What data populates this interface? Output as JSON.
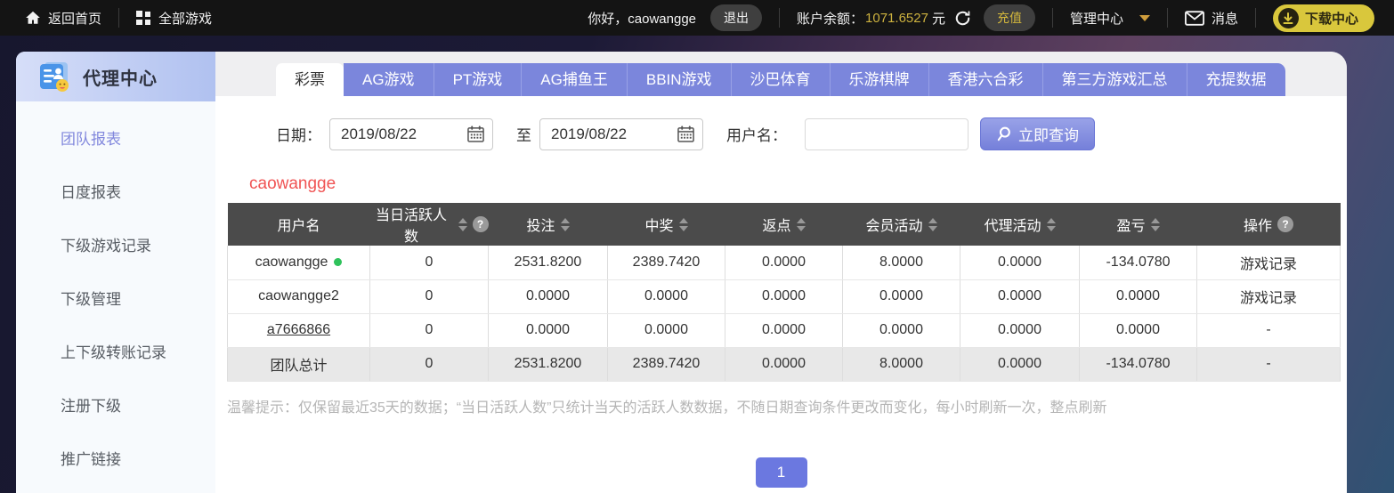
{
  "topbar": {
    "home": "返回首页",
    "all_games": "全部游戏",
    "greeting": "你好，caowangge",
    "logout": "退出",
    "balance_label": "账户余额：",
    "balance_value": "1071.6527",
    "balance_unit": "元",
    "recharge": "充值",
    "admin_center": "管理中心",
    "messages": "消息",
    "download_center": "下载中心"
  },
  "sidebar": {
    "title": "代理中心",
    "items": [
      {
        "label": "团队报表",
        "active": true
      },
      {
        "label": "日度报表",
        "active": false
      },
      {
        "label": "下级游戏记录",
        "active": false
      },
      {
        "label": "下级管理",
        "active": false
      },
      {
        "label": "上下级转账记录",
        "active": false
      },
      {
        "label": "注册下级",
        "active": false
      },
      {
        "label": "推广链接",
        "active": false
      }
    ]
  },
  "tabs": [
    {
      "label": "彩票",
      "active": true
    },
    {
      "label": "AG游戏",
      "active": false
    },
    {
      "label": "PT游戏",
      "active": false
    },
    {
      "label": "AG捕鱼王",
      "active": false
    },
    {
      "label": "BBIN游戏",
      "active": false
    },
    {
      "label": "沙巴体育",
      "active": false
    },
    {
      "label": "乐游棋牌",
      "active": false
    },
    {
      "label": "香港六合彩",
      "active": false
    },
    {
      "label": "第三方游戏汇总",
      "active": false
    },
    {
      "label": "充提数据",
      "active": false
    }
  ],
  "filters": {
    "date_label": "日期：",
    "date_from": "2019/08/22",
    "to_label": "至",
    "date_to": "2019/08/22",
    "username_label": "用户名：",
    "username_value": "",
    "search_button": "立即查询"
  },
  "report": {
    "agent_name": "caowangge",
    "columns": [
      {
        "label": "用户名"
      },
      {
        "label": "当日活跃人数"
      },
      {
        "label": "投注"
      },
      {
        "label": "中奖"
      },
      {
        "label": "返点"
      },
      {
        "label": "会员活动"
      },
      {
        "label": "代理活动"
      },
      {
        "label": "盈亏"
      },
      {
        "label": "操作"
      }
    ],
    "rows": [
      {
        "username": "caowangge",
        "online": true,
        "active_count": "0",
        "bet": "2531.8200",
        "win": "2389.7420",
        "rebate": "0.0000",
        "member_activity": "8.0000",
        "agent_activity": "0.0000",
        "profit": "-134.0780",
        "action": "游戏记录"
      },
      {
        "username": "caowangge2",
        "online": false,
        "active_count": "0",
        "bet": "0.0000",
        "win": "0.0000",
        "rebate": "0.0000",
        "member_activity": "0.0000",
        "agent_activity": "0.0000",
        "profit": "0.0000",
        "action": "游戏记录"
      },
      {
        "username": "a7666866",
        "online": false,
        "active_count": "0",
        "bet": "0.0000",
        "win": "0.0000",
        "rebate": "0.0000",
        "member_activity": "0.0000",
        "agent_activity": "0.0000",
        "profit": "0.0000",
        "action": "-"
      },
      {
        "username": "团队总计",
        "online": false,
        "active_count": "0",
        "bet": "2531.8200",
        "win": "2389.7420",
        "rebate": "0.0000",
        "member_activity": "8.0000",
        "agent_activity": "0.0000",
        "profit": "-134.0780",
        "action": "-"
      }
    ],
    "tip": "温馨提示：仅保留最近35天的数据；“当日活跃人数”只统计当天的活跃人数数据，不随日期查询条件更改而变化，每小时刷新一次，整点刷新",
    "pagination_current": "1"
  },
  "colors": {
    "accent_purple": "#7b86dc",
    "accent_yellow": "#d3b73c",
    "agent_name_red": "#f05454",
    "online_green": "#2fc25b",
    "table_header": "#4b4b4b"
  }
}
